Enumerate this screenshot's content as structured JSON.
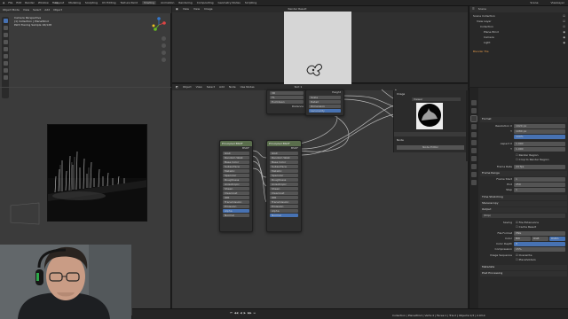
{
  "topbar": {
    "menus": [
      "File",
      "Edit",
      "Render",
      "Window",
      "Help"
    ],
    "workspaces": [
      "Layout",
      "Modeling",
      "Sculpting",
      "UV Editing",
      "Texture Paint",
      "Shading",
      "Animation",
      "Rendering",
      "Compositing",
      "Geometry Nodes",
      "Scripting"
    ],
    "active_workspace": "Shading",
    "scene_label": "Scene",
    "viewlayer_label": "ViewLayer"
  },
  "viewport": {
    "header_items": [
      "Object Mode",
      "View",
      "Select",
      "Add",
      "Object"
    ],
    "info_line1": "Camera Perspective",
    "info_line2": "(1) Collection | PlaneWind",
    "info_line3": "Path Tracing Sample 16/128"
  },
  "image_editor": {
    "header_items": [
      "View",
      "View",
      "Image"
    ],
    "image_name": "Render Result"
  },
  "node_editor": {
    "header_items": [
      "Object",
      "View",
      "Select",
      "Add",
      "Node",
      "Use Nodes"
    ],
    "slot_label": "Slot 1",
    "nodes": [
      {
        "title": "Voronoi Texture",
        "rows": [
          "Distance",
          "Color",
          "Position",
          "W",
          "Radius"
        ],
        "fields": [
          "3D",
          "F1",
          "Euclidean"
        ]
      },
      {
        "title": "Musgrave Texture",
        "rows": [
          "Height"
        ],
        "fields": [
          "Scale",
          "Detail",
          "Dimension",
          "Lacunarity",
          "Offset"
        ]
      },
      {
        "title": "Principled BSDF",
        "rows": [
          "BSDF"
        ],
        "fields": [
          "GGX",
          "Random Walk",
          "Base Color",
          "Subsurface",
          "Metallic",
          "Specular",
          "Roughness",
          "Anisotropic",
          "Sheen",
          "Clearcoat",
          "IOR",
          "Transmission",
          "Emission",
          "Alpha",
          "Normal"
        ]
      },
      {
        "title": "Principled BSDF",
        "rows": [
          "BSDF"
        ],
        "fields": [
          "GGX",
          "Random Walk",
          "Base Color",
          "Subsurface",
          "Metallic",
          "Specular",
          "Roughness",
          "Anisotropic",
          "Sheen",
          "Clearcoat",
          "IOR",
          "Transmission",
          "Emission",
          "Alpha",
          "Normal"
        ]
      }
    ],
    "npanel": {
      "section_image": "Image",
      "image_name": "Viewer",
      "section_node": "Node",
      "node_name_label": "Name",
      "node_label_label": "Label",
      "button": "Node Editor"
    }
  },
  "outliner": {
    "header_label": "Scene",
    "rows": [
      "Scene Collection",
      "View Layer",
      "Collection",
      "Plane.Wind",
      "Camera",
      "Light",
      "Blender File"
    ]
  },
  "properties": {
    "section_format": "Format",
    "resolution_x_label": "Resolution X",
    "resolution_x": "1920 px",
    "resolution_y_label": "Y",
    "resolution_y": "1080 px",
    "percent": "100%",
    "aspect_x_label": "Aspect X",
    "aspect_x": "1.000",
    "aspect_y_label": "Y",
    "aspect_y": "1.000",
    "render_region": "Render Region",
    "crop": "Crop to Render Region",
    "frame_rate_label": "Frame Rate",
    "frame_rate": "24 fps",
    "section_frame_range": "Frame Range",
    "frame_start_label": "Frame Start",
    "frame_start": "1",
    "end_label": "End",
    "end": "250",
    "step_label": "Step",
    "step": "1",
    "section_time_stretching": "Time Stretching",
    "section_stereoscopy": "Stereoscopy",
    "section_output": "Output",
    "output_path": "/tmp/",
    "saving_label": "Saving",
    "file_extensions": "File Extensions",
    "cache_result": "Cache Result",
    "file_format_label": "File Format",
    "file_format": "PNG",
    "color_label": "Color",
    "color_bw": "BW",
    "color_rgb": "RGB",
    "color_rgba": "RGBA",
    "color_depth_label": "Color Depth",
    "color_depth": "8",
    "compression_label": "Compression",
    "compression": "15%",
    "image_sequence_label": "Image Sequence",
    "overwrite": "Overwrite",
    "placeholders": "Placeholders",
    "section_metadata": "Metadata",
    "section_post_processing": "Post Processing"
  },
  "statusbar": {
    "text": "Collection | PlaneWind | Verts:4 | Faces:1 | Tris:2 | Objects:1/3 | 2.93.0"
  },
  "colors": {
    "accent": "#4772b3",
    "node_header_texture": "#5a6e4c",
    "selection": "#334d80"
  }
}
